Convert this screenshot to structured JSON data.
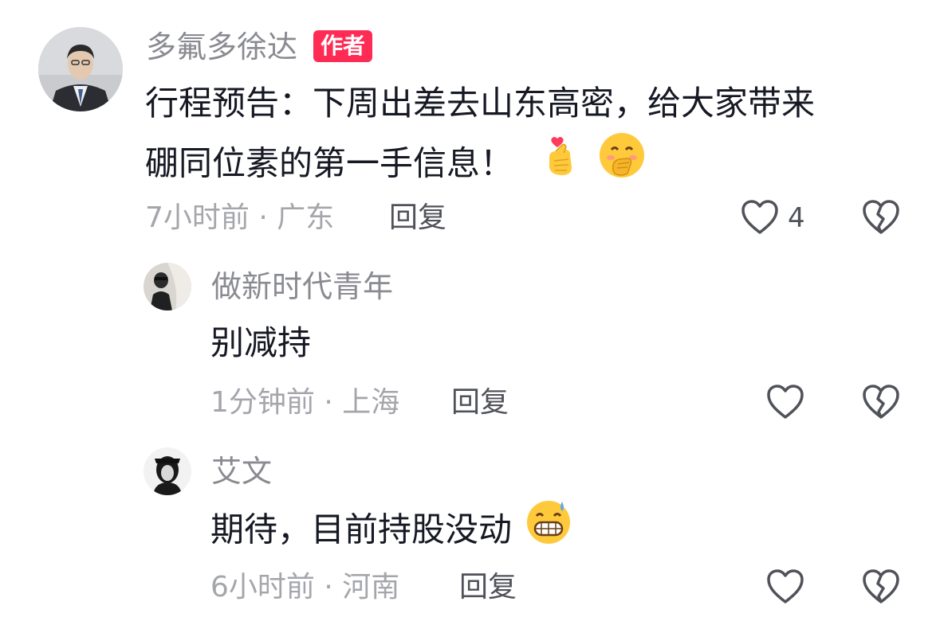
{
  "comments": [
    {
      "username": "多氟多徐达",
      "badge": "作者",
      "text_line1": "行程预告：下周出差去山东高密，给大家带来",
      "text_line2": "硼同位素的第一手信息！",
      "meta": "7小时前 · 广东",
      "reply_label": "回复",
      "like_count": "4",
      "emojis": [
        "finger-heart",
        "hand-over-mouth-smile"
      ]
    },
    {
      "username": "做新时代青年",
      "text": "别减持",
      "meta": "1分钟前 · 上海",
      "reply_label": "回复"
    },
    {
      "username": "艾文",
      "text": "期待，目前持股没动",
      "meta": "6小时前 · 河南",
      "reply_label": "回复",
      "emojis": [
        "grin-sweat"
      ]
    }
  ],
  "colors": {
    "badge": "#fe2c55",
    "username": "#8a8b91",
    "meta": "#a5a6ab",
    "text": "#161823"
  },
  "icons": [
    "heart-icon",
    "broken-heart-icon"
  ]
}
